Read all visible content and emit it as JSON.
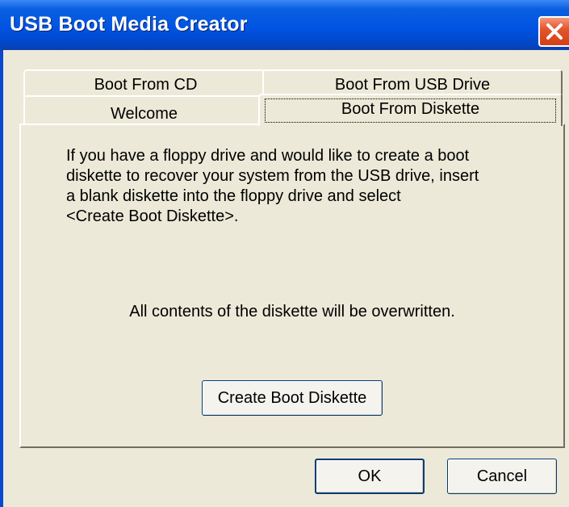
{
  "window": {
    "title": "USB Boot Media Creator",
    "close_icon": "close-icon"
  },
  "tabs": {
    "row1": [
      {
        "label": "Boot From CD"
      },
      {
        "label": "Boot From USB Drive"
      }
    ],
    "row2": [
      {
        "label": "Welcome"
      },
      {
        "label": "Boot From Diskette",
        "selected": true
      }
    ]
  },
  "panel": {
    "info_lines": [
      "If you have a floppy drive and would like to create a boot",
      "diskette to recover your system from the USB drive, insert",
      "a blank diskette into the floppy drive and select",
      "<Create Boot Diskette>."
    ],
    "warning": "All contents of the diskette will be overwritten.",
    "create_button": "Create Boot Diskette"
  },
  "footer": {
    "ok_label": "OK",
    "cancel_label": "Cancel"
  },
  "colors": {
    "titlebar": "#0054e3",
    "dialog_bg": "#ece9d8",
    "close_button": "#e5552d"
  }
}
